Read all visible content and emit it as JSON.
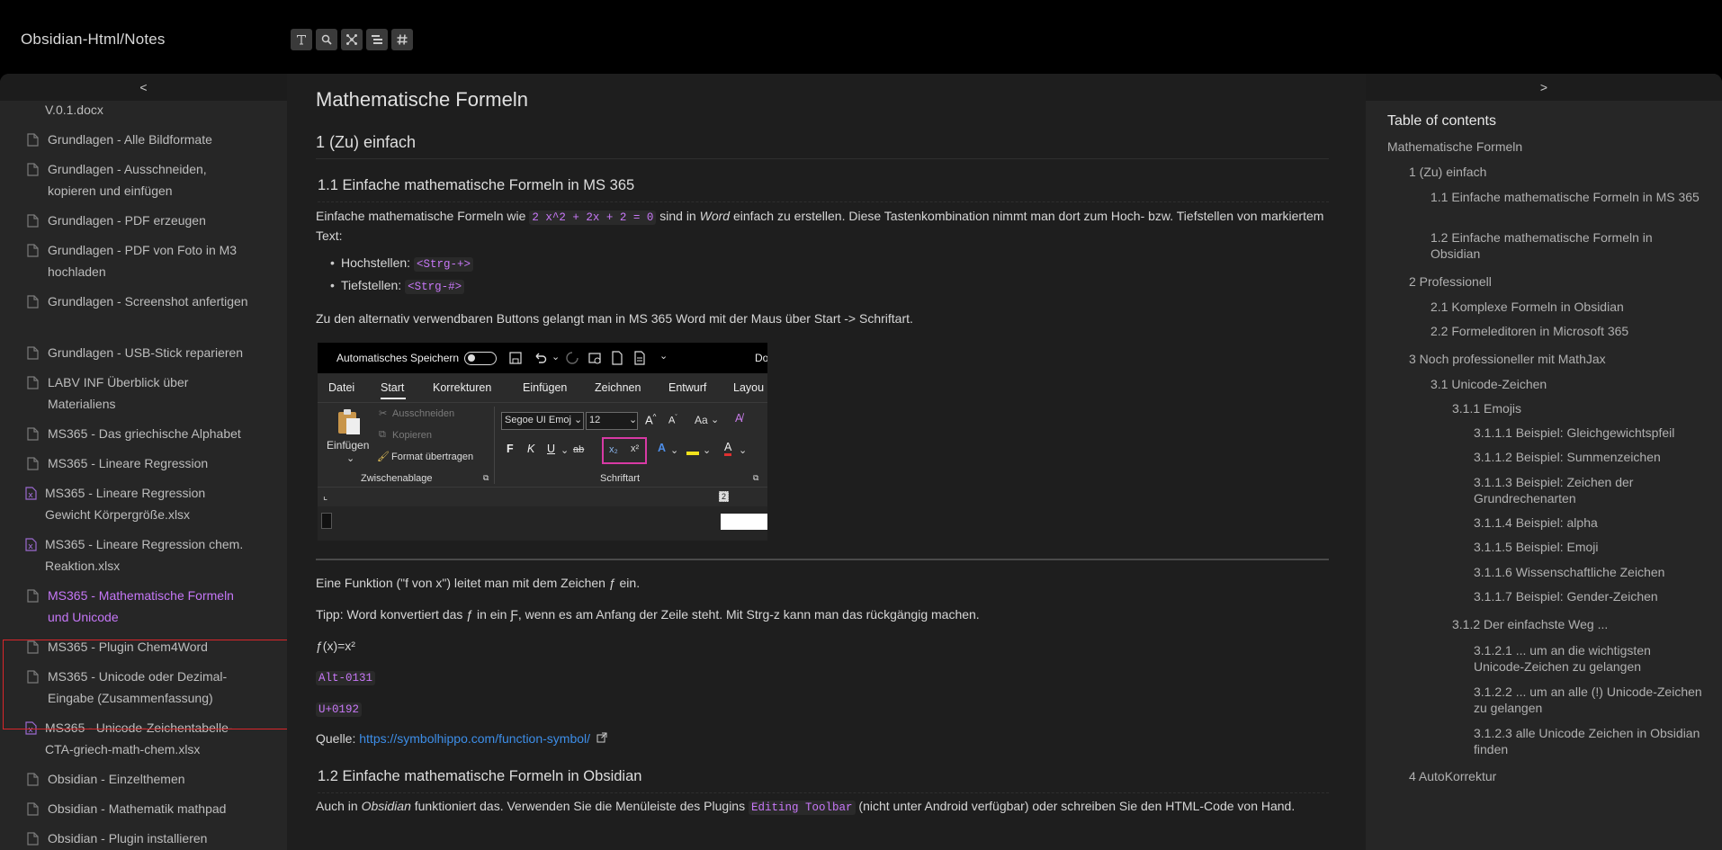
{
  "header": {
    "site_title": "Obsidian-Html/Notes",
    "toolbar": [
      "text-icon",
      "search-icon",
      "graph-icon",
      "tree-icon",
      "tag-icon"
    ]
  },
  "left_sidebar": {
    "collapse_label": "<",
    "files": [
      {
        "label": "V.0.1.docx",
        "icon": "none"
      },
      {
        "label": "Grundlagen - Alle Bildformate",
        "icon": "file"
      },
      {
        "label": "Grundlagen - Ausschneiden, kopieren und einfügen",
        "icon": "file"
      },
      {
        "label": "Grundlagen - PDF erzeugen",
        "icon": "file"
      },
      {
        "label": "Grundlagen - PDF von Foto in M3 hochladen",
        "icon": "file"
      },
      {
        "label": "Grundlagen - Screenshot anfertigen",
        "icon": "file"
      },
      {
        "label": "Grundlagen - USB-Stick reparieren",
        "icon": "file"
      },
      {
        "label": "LABV INF Überblick über Materialiens",
        "icon": "file"
      },
      {
        "label": "MS365 - Das griechische Alphabet",
        "icon": "file"
      },
      {
        "label": "MS365 - Lineare Regression",
        "icon": "file"
      },
      {
        "label": "MS365 - Lineare Regression Gewicht Körpergröße.xlsx",
        "icon": "xlsx"
      },
      {
        "label": "MS365 - Lineare Regression chem. Reaktion.xlsx",
        "icon": "xlsx"
      },
      {
        "label": "MS365 - Mathematische Formeln und Unicode",
        "icon": "file",
        "active": true
      },
      {
        "label": "MS365 - Plugin Chem4Word",
        "icon": "file"
      },
      {
        "label": "MS365 - Unicode oder Dezimal-Eingabe (Zusammenfassung)",
        "icon": "file"
      },
      {
        "label": "MS365 - Unicode-Zeichentabelle-CTA-griech-math-chem.xlsx",
        "icon": "xlsx"
      },
      {
        "label": "Obsidian - Einzelthemen",
        "icon": "file"
      },
      {
        "label": "Obsidian - Mathematik mathpad",
        "icon": "file"
      },
      {
        "label": "Obsidian - Plugin installieren",
        "icon": "file"
      }
    ]
  },
  "main": {
    "title": "Mathematische Formeln",
    "h2_1": "1 (Zu) einfach",
    "h3_1": "1.1 Einfache mathematische Formeln in MS 365",
    "p1_before": "Einfache mathematische Formeln wie ",
    "p1_code": "2 x^2 + 2x + 2 = 0",
    "p1_mid": " sind in ",
    "p1_em": "Word",
    "p1_after": " einfach zu erstellen. Diese Tastenkombination nimmt man dort zum Hoch- bzw. Tiefstellen von markiertem Text:",
    "bullet1_label": "Hochstellen: ",
    "bullet1_code": "<Strg-+>",
    "bullet2_label": "Tiefstellen: ",
    "bullet2_code": "<Strg-#>",
    "p2": "Zu den alternativ verwendbaren Buttons gelangt man in MS 365 Word mit der Maus über Start -> Schriftart.",
    "ribbon": {
      "autosave": "Automatisches Speichern",
      "doc_title_fragment": "Do",
      "tabs": [
        "Datei",
        "Start",
        "Korrekturen",
        "Einfügen",
        "Zeichnen",
        "Entwurf",
        "Layou"
      ],
      "paste": "Einfügen",
      "cut": "Ausschneiden",
      "copy": "Kopieren",
      "format_painter": "Format übertragen",
      "clipboard_group": "Zwischenablage",
      "font_name": "Segoe UI Emoj",
      "font_size": "12",
      "font_group": "Schriftart",
      "bold": "F",
      "italic": "K",
      "underline": "U",
      "strike": "ab",
      "subscript": "x₂",
      "superscript": "x²",
      "case": "Aa",
      "ruler": "2"
    },
    "p3": "Eine Funktion (\"f von x\") leitet man mit dem Zeichen ƒ ein.",
    "p4": "Tipp: Word konvertiert das ƒ in ein Ƒ, wenn es am Anfang der Zeile steht. Mit Strg-z kann man das rückgängig machen.",
    "p5": "ƒ(x)=x²",
    "code1": "Alt-0131",
    "code2": "U+0192",
    "source_label": "Quelle: ",
    "source_link": "https://symbolhippo.com/function-symbol/",
    "h3_2": "1.2 Einfache mathematische Formeln in Obsidian",
    "p6_before": "Auch in ",
    "p6_em": "Obsidian",
    "p6_mid": " funktioniert das. Verwenden Sie die Menüleiste des Plugins ",
    "p6_code": "Editing Toolbar",
    "p6_after": " (nicht unter Android verfügbar) oder schreiben Sie den HTML-Code von Hand."
  },
  "toc": {
    "collapse_label": ">",
    "title": "Table of contents",
    "items": [
      "Mathematische Formeln",
      "1 (Zu) einfach",
      "1.1 Einfache mathematische Formeln in MS 365",
      "1.2 Einfache mathematische Formeln in Obsidian",
      "2 Professionell",
      "2.1 Komplexe Formeln in Obsidian",
      "2.2 Formeleditoren in Microsoft 365",
      "3 Noch professioneller mit MathJax",
      "3.1 Unicode-Zeichen",
      "3.1.1 Emojis",
      "3.1.1.1 Beispiel: Gleichgewichtspfeil",
      "3.1.1.2 Beispiel: Summenzeichen",
      "3.1.1.3 Beispiel: Zeichen der Grundrechenarten",
      "3.1.1.4 Beispiel: alpha",
      "3.1.1.5 Beispiel: Emoji",
      "3.1.1.6 Wissenschaftliche Zeichen",
      "3.1.1.7 Beispiel: Gender-Zeichen",
      "3.1.2 Der einfachste Weg ...",
      "3.1.2.1 ... um an die wichtigsten Unicode-Zeichen zu gelangen",
      "3.1.2.2 ... um an alle (!) Unicode-Zeichen zu gelangen",
      "3.1.2.3 alle Unicode Zeichen in Obsidian finden",
      "4 AutoKorrektur"
    ]
  },
  "colors": {
    "accent": "#c577f7",
    "link": "#3d8ee8",
    "highlight_border": "#d9262b"
  }
}
